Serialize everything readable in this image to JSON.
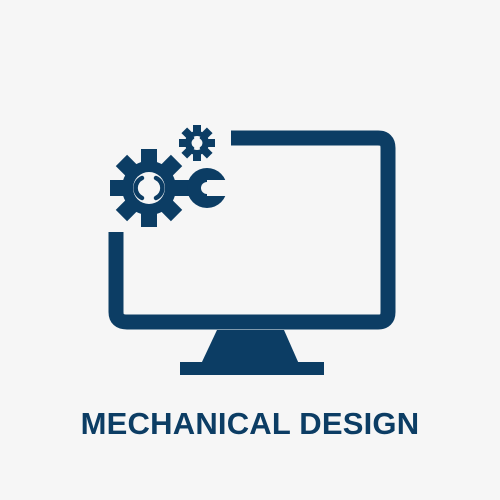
{
  "caption": "MECHANICAL DESIGN",
  "colors": {
    "background": "#f6f6f6",
    "icon": "#0c3d64"
  },
  "icons": {
    "monitor": "monitor-icon",
    "large_gear": "gear-icon",
    "small_gear": "small-gear-icon",
    "wrench": "wrench-icon"
  }
}
